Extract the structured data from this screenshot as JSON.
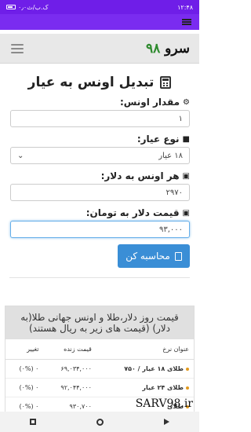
{
  "status": {
    "time": "۱۲:۴۸",
    "network": "۰٫۰ک.ب/ث"
  },
  "header": {
    "logo_text": "سرو",
    "logo_num": "۹۸"
  },
  "converter": {
    "title": "تبدیل اونس به عیار",
    "ounce_label": "مقدار اونس:",
    "ounce_value": "۱",
    "karat_label": "نوع عیار:",
    "karat_value": "۱۸ عیار",
    "price_label": "هر اونس به دلار:",
    "price_value": "۲۹۷۰",
    "usd_label": "قیمت دلار به تومان:",
    "usd_value": "۹۳,۰۰۰",
    "submit_label": "محاسبه کن"
  },
  "prices": {
    "heading": "قیمت روز دلار،طلا و اونس جهانی طلا(به دلار) (قیمت های زیر به ریال هستند)",
    "columns": [
      "عنوان نرخ",
      "قیمت زنده",
      "تغییر"
    ],
    "rows": [
      {
        "name": "طلای ۱۸ عیار / ۷۵۰",
        "price": "۶۹,۰۳۴,۰۰۰",
        "change": "۰ (۰%)"
      },
      {
        "name": "طلای ۲۴ عیار",
        "price": "۹۲,۰۴۴,۰۰۰",
        "change": "۰ (۰%)"
      },
      {
        "name": "طلای",
        "price": "۹۳۰,۷۰۰",
        "change": "۰ (۰%)"
      }
    ]
  },
  "watermark": "SARV98.ir",
  "colors": {
    "statusbar": "#6f1ee8",
    "accent": "#3a8ed6",
    "logo_number": "#2d8a2d"
  }
}
